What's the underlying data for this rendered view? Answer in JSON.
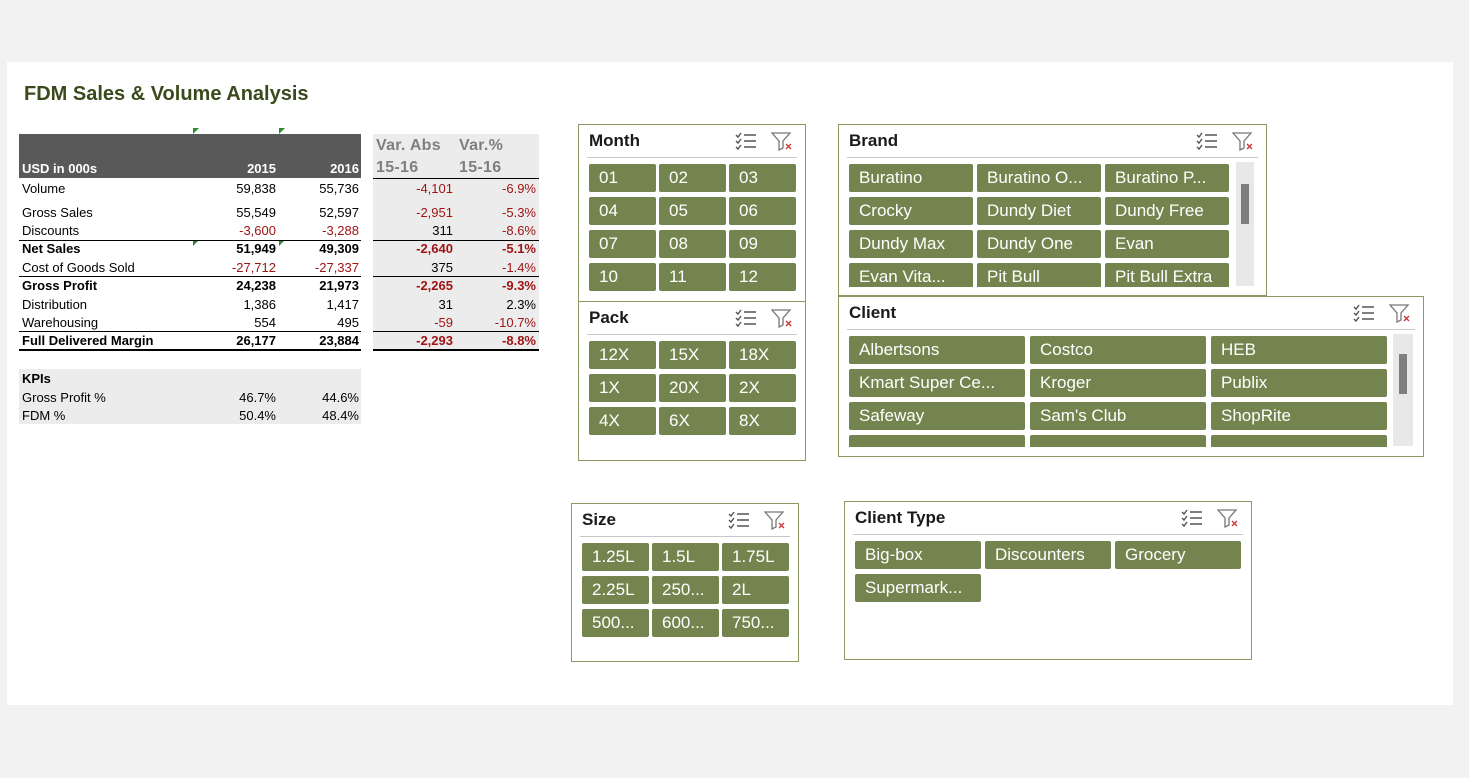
{
  "title": "FDM Sales & Volume Analysis",
  "table": {
    "header": {
      "label": "USD in 000s",
      "y1": "2015",
      "y2": "2016"
    },
    "var_header": {
      "abs1": "Var. Abs",
      "abs2": "15-16",
      "pct1": "Var.%",
      "pct2": "15-16"
    },
    "rows": [
      {
        "label": "Volume",
        "y1": "59,838",
        "y2": "55,736",
        "abs": "-4,101",
        "pct": "-6.9%"
      },
      {
        "label": "Gross Sales",
        "y1": "55,549",
        "y2": "52,597",
        "abs": "-2,951",
        "pct": "-5.3%"
      },
      {
        "label": "Discounts",
        "y1": "-3,600",
        "y2": "-3,288",
        "abs": "311",
        "pct": "-8.6%"
      },
      {
        "label": "Net Sales",
        "y1": "51,949",
        "y2": "49,309",
        "abs": "-2,640",
        "pct": "-5.1%"
      },
      {
        "label": "Cost of Goods Sold",
        "y1": "-27,712",
        "y2": "-27,337",
        "abs": "375",
        "pct": "-1.4%"
      },
      {
        "label": "Gross Profit",
        "y1": "24,238",
        "y2": "21,973",
        "abs": "-2,265",
        "pct": "-9.3%"
      },
      {
        "label": "Distribution",
        "y1": "1,386",
        "y2": "1,417",
        "abs": "31",
        "pct": "2.3%"
      },
      {
        "label": "Warehousing",
        "y1": "554",
        "y2": "495",
        "abs": "-59",
        "pct": "-10.7%"
      },
      {
        "label": "Full Delivered Margin",
        "y1": "26,177",
        "y2": "23,884",
        "abs": "-2,293",
        "pct": "-8.8%"
      }
    ],
    "kpis": {
      "label": "KPIs",
      "rows": [
        {
          "label": "Gross Profit %",
          "y1": "46.7%",
          "y2": "44.6%"
        },
        {
          "label": "FDM %",
          "y1": "50.4%",
          "y2": "48.4%"
        }
      ]
    }
  },
  "slicers": {
    "month": {
      "title": "Month",
      "items": [
        "01",
        "02",
        "03",
        "04",
        "05",
        "06",
        "07",
        "08",
        "09",
        "10",
        "11",
        "12"
      ]
    },
    "pack": {
      "title": "Pack",
      "items": [
        "12X",
        "15X",
        "18X",
        "1X",
        "20X",
        "2X",
        "4X",
        "6X",
        "8X"
      ]
    },
    "size": {
      "title": "Size",
      "items": [
        "1.25L",
        "1.5L",
        "1.75L",
        "2.25L",
        "250...",
        "2L",
        "500...",
        "600...",
        "750..."
      ]
    },
    "brand": {
      "title": "Brand",
      "items": [
        "Buratino",
        "Buratino O...",
        "Buratino P...",
        "Crocky",
        "Dundy Diet",
        "Dundy Free",
        "Dundy Max",
        "Dundy One",
        "Evan",
        "Evan Vita...",
        "Pit Bull",
        "Pit Bull Extra"
      ]
    },
    "client": {
      "title": "Client",
      "items": [
        "Albertsons",
        "Costco",
        "HEB",
        "Kmart Super Ce...",
        "Kroger",
        "Publix",
        "Safeway",
        "Sam's Club",
        "ShopRite",
        "",
        "",
        ""
      ]
    },
    "client_type": {
      "title": "Client Type",
      "items": [
        "Big-box",
        "Discounters",
        "Grocery",
        "Supermark..."
      ]
    }
  },
  "colors": {
    "button": "#74844f",
    "border": "#8b9a63",
    "negative": "#a01414",
    "header": "#595959"
  },
  "icons": {
    "multi_select": "multi-select-icon",
    "clear_filter": "clear-filter-icon"
  }
}
